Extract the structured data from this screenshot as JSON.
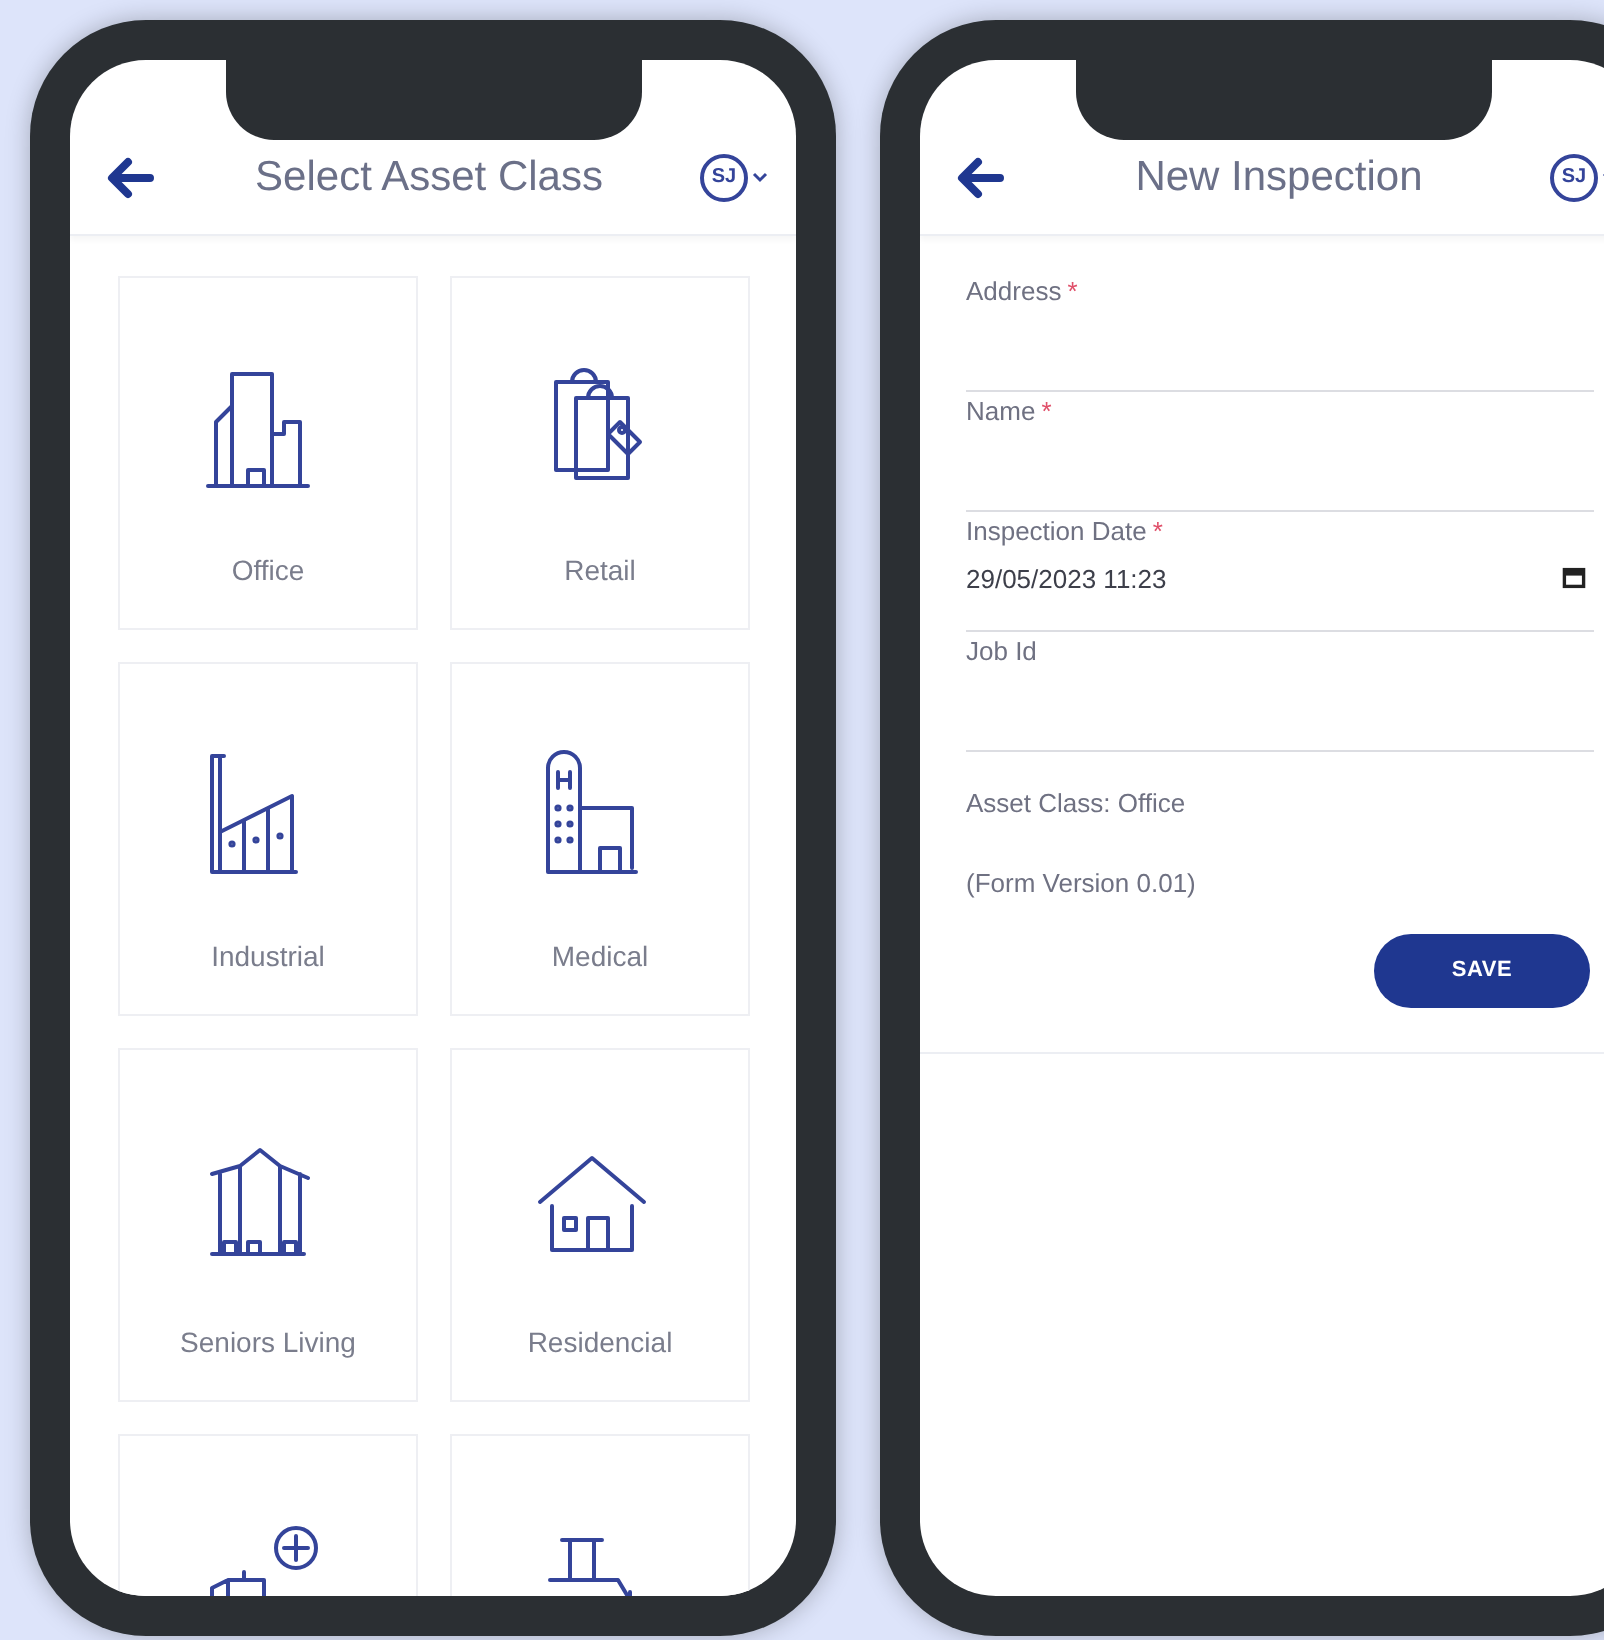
{
  "screens": [
    {
      "kind": "grid",
      "title": "Select Asset Class",
      "avatar": "SJ",
      "asset_classes": [
        {
          "kind": "office",
          "label": "Office"
        },
        {
          "kind": "retail",
          "label": "Retail"
        },
        {
          "kind": "industrial",
          "label": "Industrial"
        },
        {
          "kind": "medical",
          "label": "Medical"
        },
        {
          "kind": "seniors",
          "label": "Seniors Living"
        },
        {
          "kind": "residential",
          "label": "Residencial"
        },
        {
          "kind": "development"
        },
        {
          "kind": "rural"
        }
      ]
    },
    {
      "kind": "form",
      "title": "New Inspection",
      "avatar": "SJ",
      "fields": [
        {
          "label": "Address",
          "required_mark": "*"
        },
        {
          "label": "Name",
          "required_mark": "*"
        },
        {
          "label": "Inspection Date",
          "required_mark": "*",
          "value": "29/05/2023 11:23",
          "kind": "datetime"
        },
        {
          "label": "Job Id"
        }
      ],
      "info": [
        "Asset Class: Office",
        "(Form Version 0.01)"
      ],
      "button": "SAVE"
    }
  ]
}
